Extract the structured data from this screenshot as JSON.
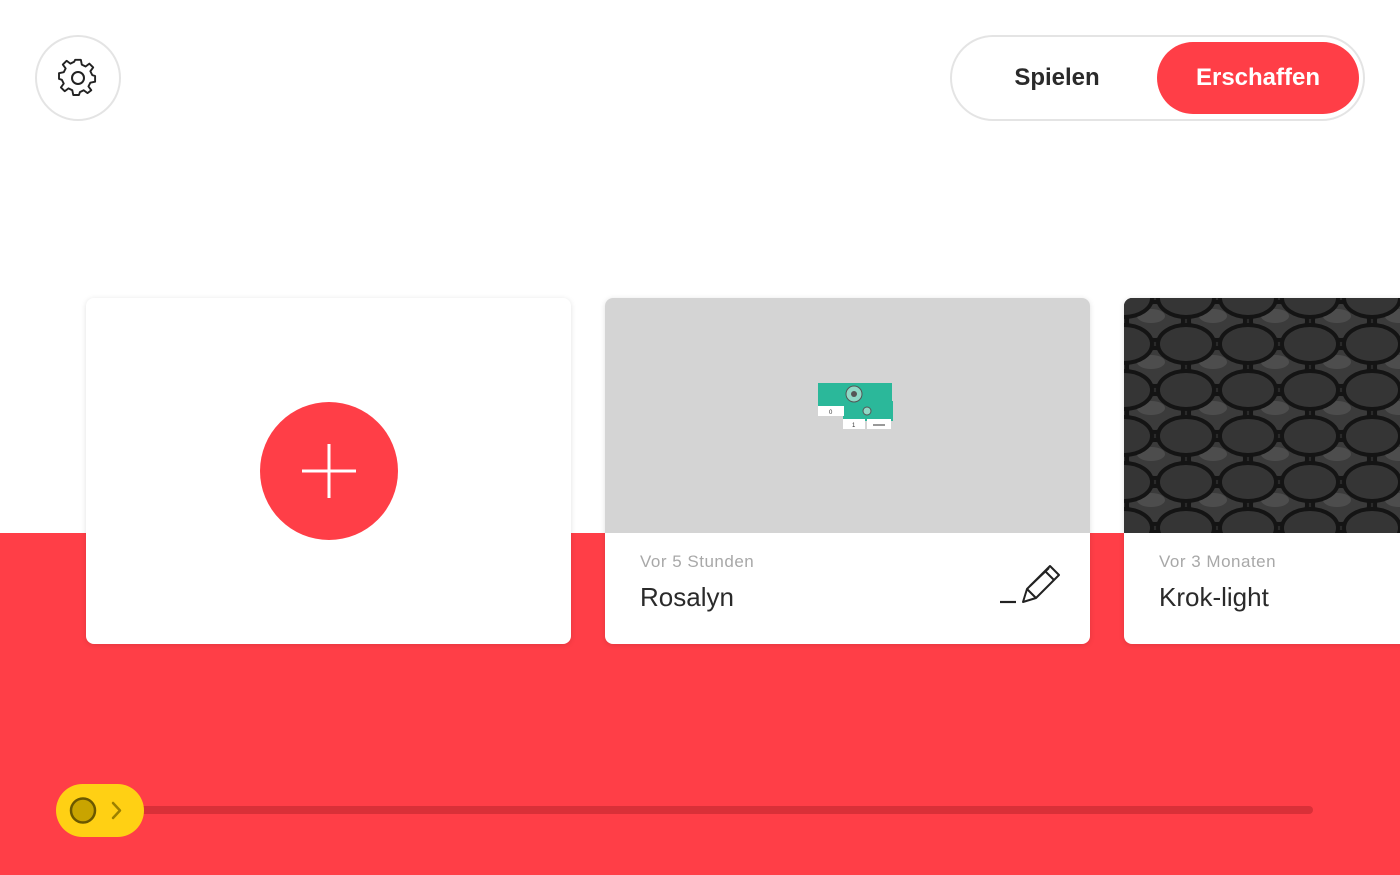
{
  "header": {
    "settings_icon": "gear-icon",
    "modes": {
      "play_label": "Spielen",
      "create_label": "Erschaffen",
      "active": "Erschaffen"
    }
  },
  "projects": {
    "new_card": {
      "icon": "plus-icon"
    },
    "items": [
      {
        "timestamp": "Vor 5 Stunden",
        "title": "Rosalyn",
        "thumbnail": "code-blocks",
        "edit_icon": "pencil-icon"
      },
      {
        "timestamp": "Vor 3 Monaten",
        "title": "Krok-light",
        "thumbnail": "crocodile-skin"
      }
    ]
  },
  "scroller": {
    "position": 0.0,
    "thumb_icon": "chevron-right-icon"
  },
  "colors": {
    "accent": "#ff3e47",
    "slider": "#ffd014",
    "blocks": "#2bb89a"
  }
}
